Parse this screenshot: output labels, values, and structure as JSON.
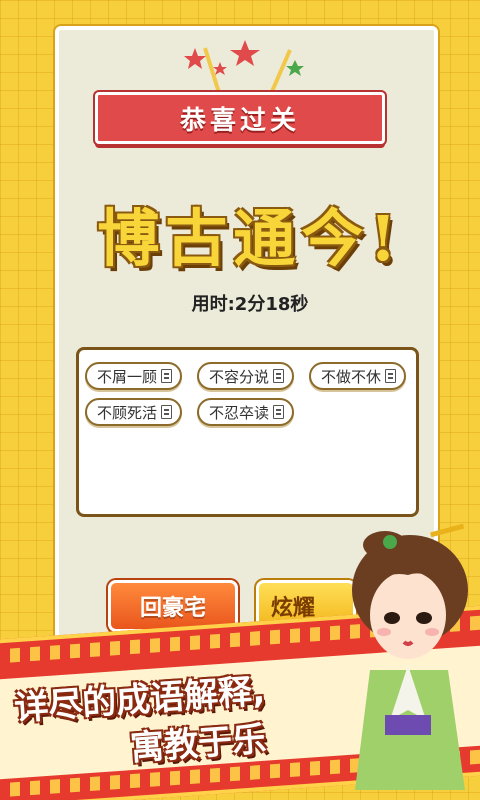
{
  "header": {
    "title": "恭喜过关"
  },
  "result": {
    "headline": "博古通今!",
    "time_text": "用时:2分18秒"
  },
  "idioms": [
    "不屑一顾",
    "不容分说",
    "不做不休",
    "不顾死活",
    "不忍卒读"
  ],
  "buttons": {
    "home": "回豪宅",
    "show": "炫耀"
  },
  "promo": {
    "line1": "详尽的成语解释,",
    "line2": "寓教于乐"
  },
  "colors": {
    "background": "#f7cf3c",
    "ribbon": "#e04a4a",
    "headline": "#f8d63a",
    "home_button": "#e9561c",
    "show_button": "#f2b51a",
    "banner": "#e63a2e"
  }
}
